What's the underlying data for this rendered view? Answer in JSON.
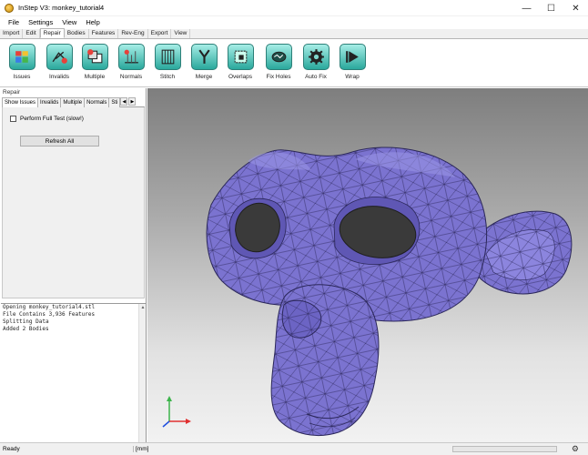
{
  "window": {
    "title": "InStep V3: monkey_tutorial4",
    "minimize": "—",
    "maximize": "☐",
    "close": "✕"
  },
  "menu": [
    "File",
    "Settings",
    "View",
    "Help"
  ],
  "ribbon_tabs": [
    "Import",
    "Edit",
    "Repair",
    "Bodies",
    "Features",
    "Rev-Eng",
    "Export",
    "View"
  ],
  "ribbon_active_tab": "Repair",
  "ribbon_buttons": [
    {
      "label": "Issues",
      "icon": "issues-icon"
    },
    {
      "label": "Invalids",
      "icon": "invalids-icon"
    },
    {
      "label": "Multiple",
      "icon": "multiple-icon"
    },
    {
      "label": "Normals",
      "icon": "normals-icon"
    },
    {
      "label": "Stitch",
      "icon": "stitch-icon"
    },
    {
      "label": "Merge",
      "icon": "merge-icon"
    },
    {
      "label": "Overlaps",
      "icon": "overlaps-icon"
    },
    {
      "label": "Fix Holes",
      "icon": "fix-holes-icon"
    },
    {
      "label": "Auto Fix",
      "icon": "auto-fix-icon"
    },
    {
      "label": "Wrap",
      "icon": "wrap-icon"
    }
  ],
  "repair_panel": {
    "caption": "Repair",
    "tabs": [
      "Show Issues",
      "Invalids",
      "Multiple",
      "Normals",
      "Sti"
    ],
    "active_tab": "Show Issues",
    "checkbox_label": "Perform Full Test (slow!)",
    "checkbox_checked": false,
    "refresh_button": "Refresh All"
  },
  "console_lines": [
    "Opening monkey_tutorial4.stl",
    "File Contains 3,936 Features",
    "Splitting Data",
    "Added 2 Bodies"
  ],
  "status": {
    "ready": "Ready",
    "units": "[mm]"
  },
  "colors": {
    "accent_teal": "#2aa89c",
    "model_fill": "#7b73d0",
    "mesh_line": "#2b275a"
  }
}
